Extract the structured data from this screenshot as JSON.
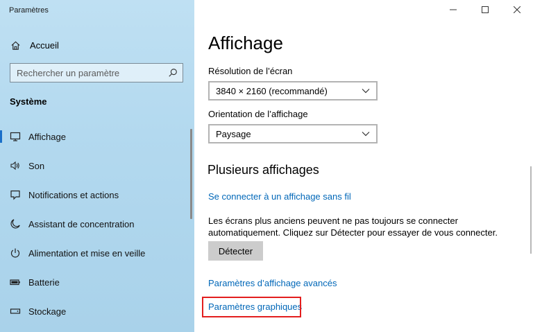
{
  "window": {
    "title": "Paramètres",
    "controls": {
      "minimize": "minimize-icon",
      "maximize": "maximize-icon",
      "close": "close-icon"
    }
  },
  "sidebar": {
    "home_label": "Accueil",
    "search_placeholder": "Rechercher un paramètre",
    "section_title": "Système",
    "items": [
      {
        "label": "Affichage",
        "icon": "monitor-icon",
        "active": true
      },
      {
        "label": "Son",
        "icon": "speaker-icon",
        "active": false
      },
      {
        "label": "Notifications et actions",
        "icon": "notification-icon",
        "active": false
      },
      {
        "label": "Assistant de concentration",
        "icon": "moon-icon",
        "active": false
      },
      {
        "label": "Alimentation et mise en veille",
        "icon": "power-icon",
        "active": false
      },
      {
        "label": "Batterie",
        "icon": "battery-icon",
        "active": false
      },
      {
        "label": "Stockage",
        "icon": "storage-icon",
        "active": false
      }
    ]
  },
  "main": {
    "title": "Affichage",
    "resolution": {
      "label": "Résolution de l’écran",
      "value": "3840 × 2160 (recommandé)"
    },
    "orientation": {
      "label": "Orientation de l’affichage",
      "value": "Paysage"
    },
    "multi_display": {
      "heading": "Plusieurs affichages",
      "wireless_link": "Se connecter à un affichage sans fil",
      "description": "Les écrans plus anciens peuvent ne pas toujours se connecter automatiquement. Cliquez sur Détecter pour essayer de vous connecter.",
      "detect_button": "Détecter",
      "advanced_link": "Paramètres d’affichage avancés",
      "graphics_link": "Paramètres graphiques"
    }
  },
  "colors": {
    "accent": "#1a6fc9",
    "link": "#0067b8",
    "highlight": "#e31e1e"
  }
}
